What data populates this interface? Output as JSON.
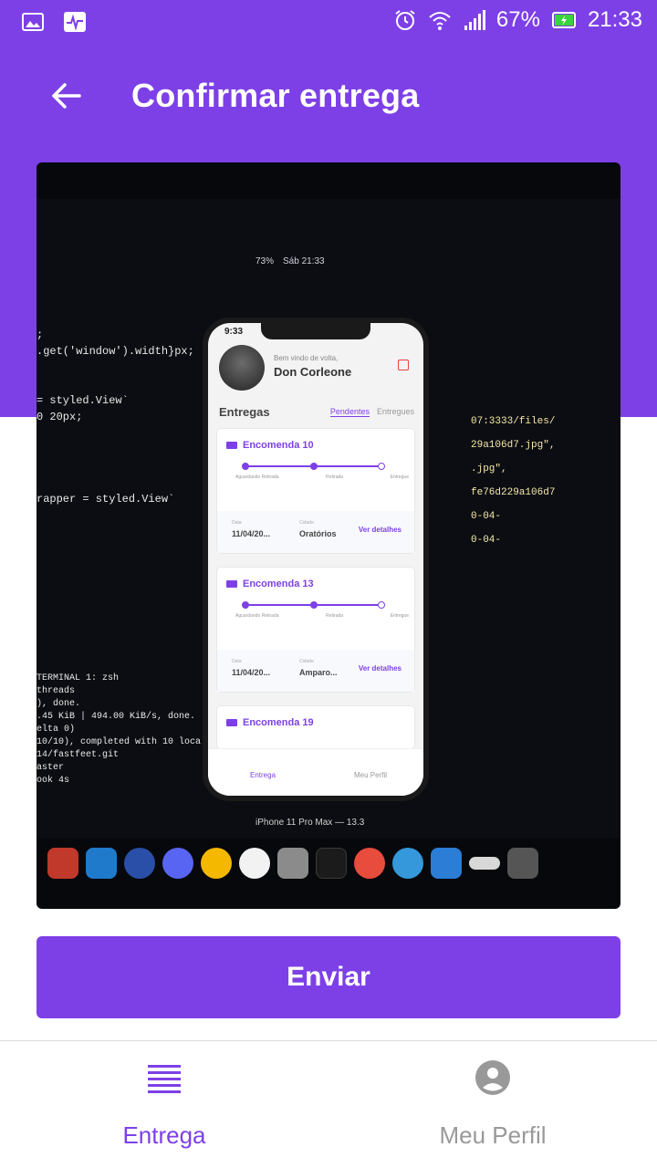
{
  "colors": {
    "primary": "#7d40e7",
    "inactive": "#999999",
    "background": "#ffffff"
  },
  "status_bar": {
    "battery": "67%",
    "time": "21:33",
    "icons": [
      "gallery-icon",
      "activity-icon",
      "alarm-icon",
      "wifi-icon",
      "signal-icon",
      "battery-charging-icon"
    ]
  },
  "header": {
    "title": "Confirmar entrega",
    "back_icon": "arrow-left-icon"
  },
  "photo": {
    "menubar": {
      "battery": "73%",
      "datetime": "Sáb 21:33"
    },
    "code_left": [
      ";",
      ".get('window').width}px;",
      "",
      "",
      "= styled.View`",
      "0 20px;",
      "",
      "",
      "",
      "",
      "rapper = styled.View`"
    ],
    "terminal": [
      "TERMINAL   1: zsh",
      "threads",
      "), done.",
      ".45 KiB | 494.00 KiB/s, done.",
      "elta 0)",
      "10/10), completed with 10 loca",
      "14/fastfeet.git",
      "aster",
      "ook 4s"
    ],
    "code_right": [
      "07:3333/files/",
      "29a106d7.jpg\",",
      ".jpg\",",
      "fe76d229a106d7",
      "0-04-",
      "0-04-"
    ],
    "phone": {
      "time": "9:33",
      "welcome": "Bem vindo de volta,",
      "user_name": "Don Corleone",
      "section_title": "Entregas",
      "tabs": [
        "Pendentes",
        "Entregues"
      ],
      "track_labels": [
        "Aguardando Retirada",
        "Retirada",
        "Entregue"
      ],
      "date_label": "Data",
      "city_label": "Cidade",
      "details_link": "Ver detalhes",
      "orders": [
        {
          "title": "Encomenda 10",
          "date": "11/04/20...",
          "city": "Oratórios"
        },
        {
          "title": "Encomenda 13",
          "date": "11/04/20...",
          "city": "Amparo..."
        },
        {
          "title": "Encomenda 19"
        }
      ],
      "tabbar": [
        "Entrega",
        "Meu Perfil"
      ]
    },
    "caption": "iPhone 11 Pro Max — 13.3"
  },
  "send_button": {
    "label": "Enviar"
  },
  "tabbar": {
    "items": [
      {
        "label": "Entrega",
        "icon": "list-icon",
        "active": true
      },
      {
        "label": "Meu Perfil",
        "icon": "user-circle-icon",
        "active": false
      }
    ]
  }
}
